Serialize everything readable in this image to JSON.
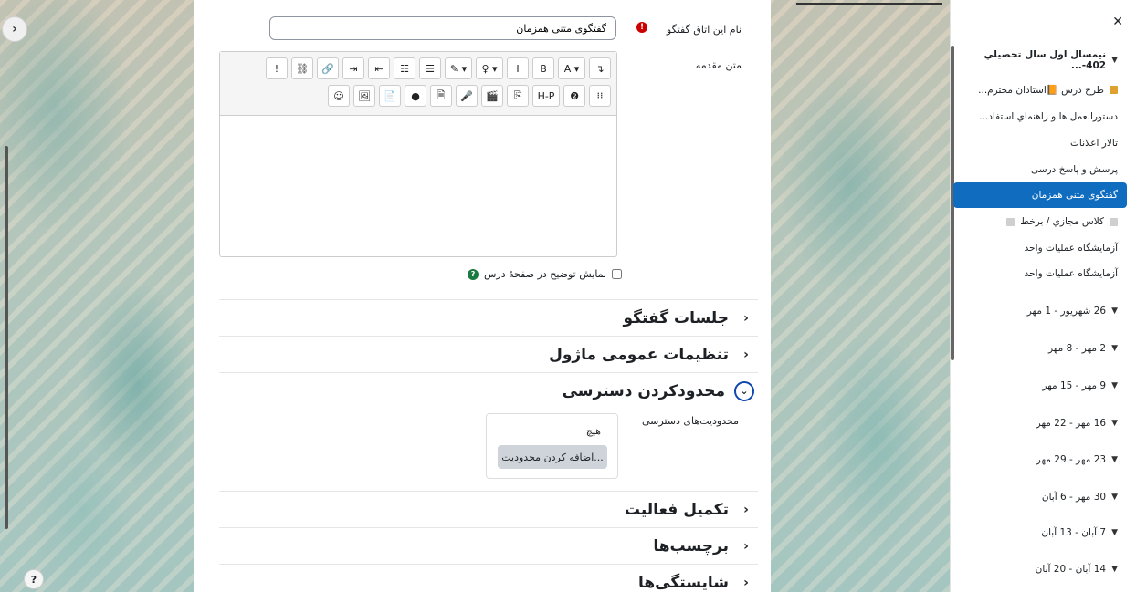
{
  "form": {
    "name_label": "نام این اتاق گفتگو",
    "name_value": "گفتگوی متنی همزمان",
    "intro_label": "متن مقدمه",
    "show_description_label": "نمایش توضیح در صفحهٔ درس"
  },
  "toolbar": {
    "row1": [
      "↴",
      "A ▾",
      "B",
      "I",
      "♀ ▾",
      "✎ ▾",
      "☰",
      "☷",
      "⇤",
      "⇥",
      "🔗",
      "⛓",
      "!"
    ],
    "row2": [
      "☺",
      "🖼",
      "📄",
      "●",
      "🗎",
      "🎤",
      "🎬",
      "⎘",
      "H-P",
      "❷",
      "⁞⁞"
    ]
  },
  "sections": {
    "chat_sessions": "جلسات گفتگو",
    "common_settings": "تنظیمات عمومی ماژول",
    "restrict_access": "محدودکردن دسترسی",
    "activity_completion": "تکمیل فعالیت",
    "tags": "برچسب‌ها",
    "competencies": "شایستگی‌ها"
  },
  "restrictions": {
    "label": "محدودیت‌های دسترسی",
    "none": "هیچ",
    "add_button": "اضافه کردن محدودیت..."
  },
  "drawer": {
    "items": [
      {
        "label": "نیمسال اول سال تحصيلي 402-...",
        "bold": true,
        "chevron": true
      },
      {
        "label": "طرح درس 📙استادان محترم...",
        "icon": "book"
      },
      {
        "label": "دستورالعمل ها و راهنماي استفاد..."
      },
      {
        "label": "تالار اعلانات"
      },
      {
        "label": "پرسش و پاسخ درسی"
      },
      {
        "label": "گفتگوی متنی همزمان",
        "active": true
      },
      {
        "label": "کلاس مجازي / برخط",
        "icon": "grey"
      },
      {
        "label": "آزمایشگاه عملیات واحد"
      },
      {
        "label": "آزمایشگاه عملیات واحد"
      },
      {
        "label": "26 شهریور - 1 مهر",
        "chevron": true
      },
      {
        "label": "2 مهر - 8 مهر",
        "chevron": true
      },
      {
        "label": "9 مهر - 15 مهر",
        "chevron": true
      },
      {
        "label": "16 مهر - 22 مهر",
        "chevron": true
      },
      {
        "label": "23 مهر - 29 مهر",
        "chevron": true
      },
      {
        "label": "30 مهر - 6 آبان",
        "chevron": true
      },
      {
        "label": "7 آبان - 13 آبان",
        "chevron": true
      },
      {
        "label": "14 آبان - 20 آبان",
        "chevron": true
      }
    ]
  },
  "help_label": "?"
}
